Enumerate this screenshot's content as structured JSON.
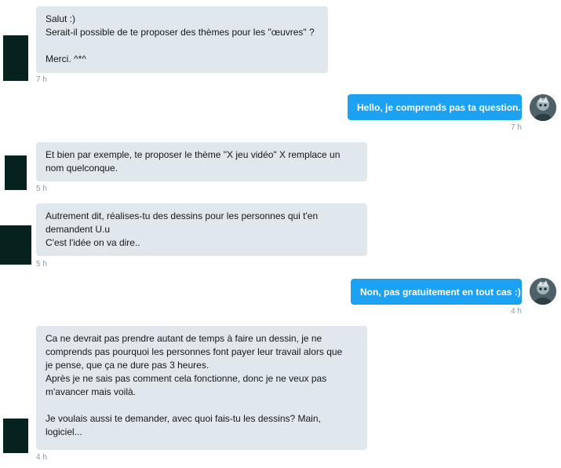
{
  "conversation": {
    "messages": [
      {
        "direction": "incoming",
        "lines": [
          "Salut :)",
          "Serait-il possible de te proposer des thèmes pour les \"œuvres\" ?",
          "",
          "Merci. ^*^"
        ],
        "time": "7 h"
      },
      {
        "direction": "outgoing",
        "lines": [
          "Hello, je comprends pas ta question."
        ],
        "time": "7 h"
      },
      {
        "direction": "incoming",
        "lines": [
          "Et bien par exemple, te proposer le thème \"X jeu vidéo\" X remplace un",
          "nom quelconque."
        ],
        "time": "5 h"
      },
      {
        "direction": "incoming",
        "lines": [
          "Autrement dit, réalises-tu des dessins pour les personnes qui t'en",
          "demandent U.u",
          "C'est l'idée on va dire.."
        ],
        "time": "5 h"
      },
      {
        "direction": "outgoing",
        "lines": [
          "Non, pas gratuitement en tout cas :)"
        ],
        "time": "4 h"
      },
      {
        "direction": "incoming",
        "lines": [
          "Ca ne devrait pas prendre autant de temps à faire un dessin, je ne",
          "comprends pas pourquoi les personnes font payer leur travail alors que",
          "je pense, que ça ne dure pas 3 heures.",
          "Après je ne sais pas comment cela fonctionne, donc je ne veux pas",
          "m'avancer mais voilà.",
          "",
          "Je voulais aussi te demander, avec quoi fais-tu les dessins? Main,",
          "logiciel..."
        ],
        "time": "4 h"
      }
    ]
  },
  "colors": {
    "incoming_bubble": "#e1e8ed",
    "outgoing_bubble": "#1da1f2",
    "timestamp": "#8899a6",
    "sender_avatar": "#06221f"
  },
  "icons": {
    "sender_avatar": "avatar-icon",
    "own_avatar": "avatar-icon"
  }
}
